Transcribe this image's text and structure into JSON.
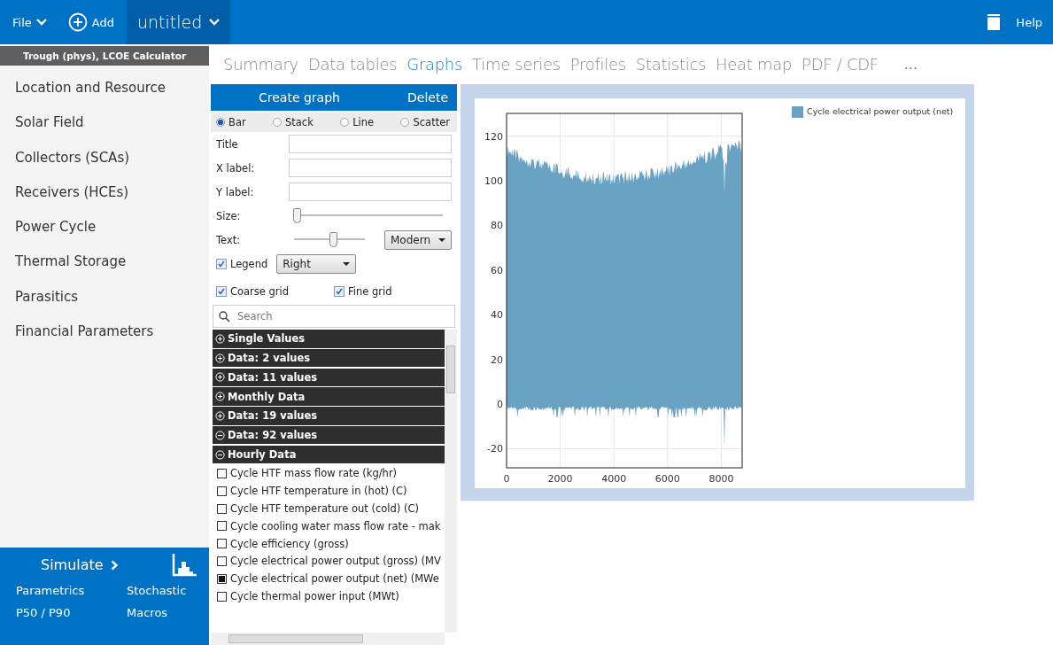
{
  "toolbar": {
    "file": "File",
    "add": "Add",
    "case_name": "untitled",
    "help": "Help"
  },
  "sidebar": {
    "header": "Trough (phys), LCOE Calculator",
    "items": [
      {
        "label": "Location and Resource"
      },
      {
        "label": "Solar Field"
      },
      {
        "label": "Collectors (SCAs)"
      },
      {
        "label": "Receivers (HCEs)"
      },
      {
        "label": "Power Cycle"
      },
      {
        "label": "Thermal Storage"
      },
      {
        "label": "Parasitics"
      },
      {
        "label": "Financial Parameters"
      }
    ],
    "simulate": "Simulate",
    "links": [
      "Parametrics",
      "Stochastic",
      "P50 / P90",
      "Macros"
    ]
  },
  "tabs": [
    {
      "label": "Summary",
      "selected": false
    },
    {
      "label": "Data tables",
      "selected": false
    },
    {
      "label": "Graphs",
      "selected": true
    },
    {
      "label": "Time series",
      "selected": false
    },
    {
      "label": "Profiles",
      "selected": false
    },
    {
      "label": "Statistics",
      "selected": false
    },
    {
      "label": "Heat map",
      "selected": false
    },
    {
      "label": "PDF / CDF",
      "selected": false
    }
  ],
  "more": "...",
  "graph_panel": {
    "create": "Create graph",
    "delete": "Delete",
    "types": [
      {
        "label": "Bar",
        "selected": true
      },
      {
        "label": "Stack",
        "selected": false
      },
      {
        "label": "Line",
        "selected": false
      },
      {
        "label": "Scatter",
        "selected": false
      }
    ],
    "fields": [
      {
        "label": "Title"
      },
      {
        "label": "X label:"
      },
      {
        "label": "Y label:"
      }
    ],
    "size": {
      "label": "Size:",
      "level": 0.02
    },
    "text": {
      "label": "Text:",
      "level": 0.55,
      "font": "Modern"
    },
    "legend": {
      "label": "Legend",
      "checked": true,
      "position": "Right"
    },
    "grids": [
      {
        "label": "Coarse grid",
        "checked": true
      },
      {
        "label": "Fine grid",
        "checked": true
      }
    ],
    "search": {
      "placeholder": "Search"
    },
    "groups": [
      {
        "label": "Single Values",
        "expanded": false
      },
      {
        "label": "Data: 2 values",
        "expanded": false
      },
      {
        "label": "Data: 11 values",
        "expanded": false
      },
      {
        "label": "Monthly Data",
        "expanded": false
      },
      {
        "label": "Data: 19 values",
        "expanded": false
      },
      {
        "label": "Data: 92 values",
        "expanded": true
      },
      {
        "label": "Hourly Data",
        "expanded": true,
        "children": [
          {
            "label": "Cycle HTF mass flow rate (kg/hr)",
            "checked": false
          },
          {
            "label": "Cycle HTF temperature in (hot) (C)",
            "checked": false
          },
          {
            "label": "Cycle HTF temperature out (cold) (C)",
            "checked": false
          },
          {
            "label": "Cycle cooling water mass flow rate - mak",
            "checked": false
          },
          {
            "label": "Cycle efficiency (gross)",
            "checked": false
          },
          {
            "label": "Cycle electrical power output (gross) (MV",
            "checked": false
          },
          {
            "label": "Cycle electrical power output (net) (MWe",
            "checked": true
          },
          {
            "label": "Cycle thermal power input (MWt)",
            "checked": false
          }
        ]
      }
    ]
  },
  "graph": {
    "legend": "Cycle electrical power output (net)",
    "yticks": [
      "120",
      "100",
      "80",
      "60",
      "40",
      "20",
      "0",
      "-20"
    ],
    "xticks": [
      "0",
      "2000",
      "4000",
      "6000",
      "8000"
    ]
  }
}
